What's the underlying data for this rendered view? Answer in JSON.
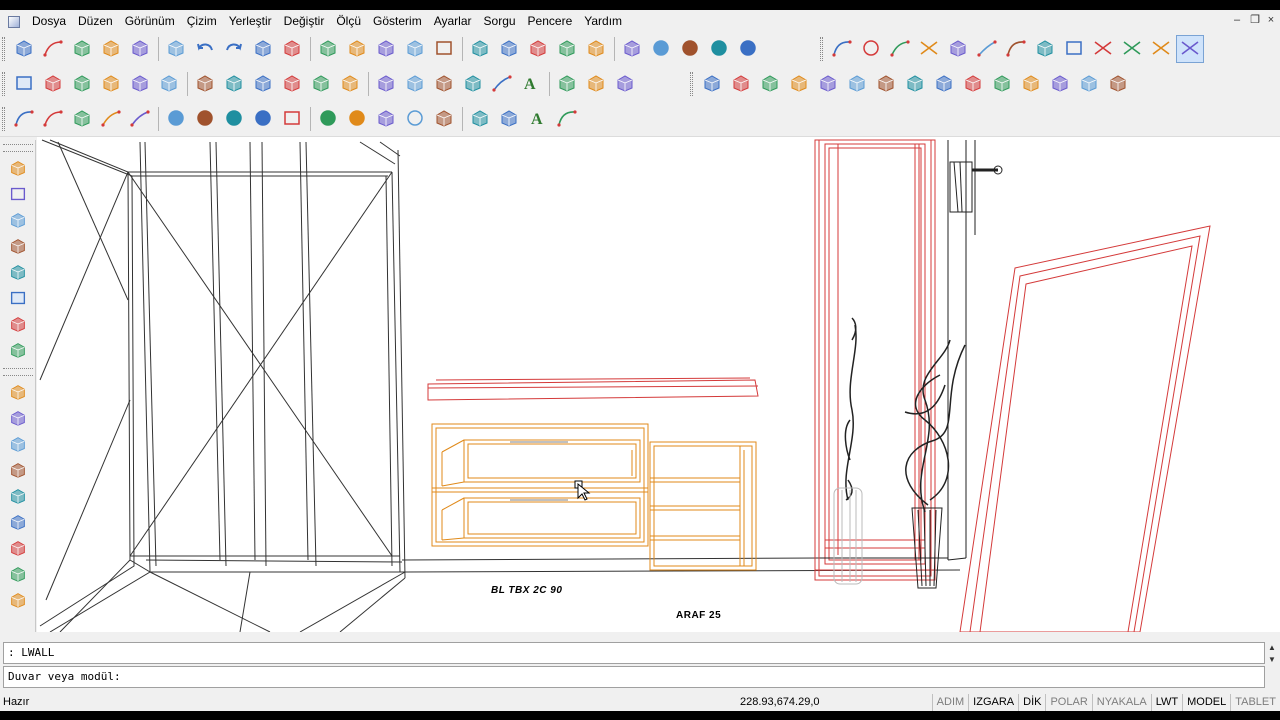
{
  "menubar": {
    "items": [
      "Dosya",
      "Düzen",
      "Görünüm",
      "Çizim",
      "Yerleştir",
      "Değiştir",
      "Ölçü",
      "Gösterim",
      "Ayarlar",
      "Sorgu",
      "Pencere",
      "Yardım"
    ]
  },
  "window_controls": [
    "minimize-icon",
    "restore-icon",
    "close-icon"
  ],
  "toolbars": {
    "row1": {
      "group1": [
        "new-icon",
        "open-icon",
        "save-icon",
        "print-icon",
        "plot-preview-icon",
        "publish-icon",
        "undo-icon",
        "redo-icon",
        "eraser-icon",
        "camera-icon",
        "measure-icon",
        "dimension-icon",
        "zoom-icon",
        "zoom-window-icon",
        "3d-box-icon",
        "3d-view-icon",
        "3d-solid-icon",
        "layers-icon",
        "eye-icon",
        "cube-wire-icon",
        "cube-render-icon",
        "sphere-red-icon",
        "sphere-red-2-icon",
        "sphere-multi-icon",
        "sphere-pink-icon"
      ],
      "group2": [
        "polyline-icon",
        "circle-icon",
        "line-icon",
        "trim-icon",
        "point-icon",
        "perpendicular-icon",
        "arc-icon",
        "polygon-icon",
        "rectangle-icon",
        "box-cross-icon",
        "extend-icon",
        "stretch-icon",
        "delete-cross-icon"
      ]
    },
    "row2": {
      "group1": [
        "grid-icon",
        "snap-icon",
        "ortho-icon",
        "osnap-icon",
        "tracking-icon",
        "rotate-icon",
        "mirror-icon",
        "move-icon",
        "copy-icon",
        "scale-icon",
        "ucs-icon",
        "layer-icon",
        "layers-stack-icon",
        "zoom-all-icon",
        "zoom-in-icon",
        "zoom-extents-icon",
        "dimension-linear-icon",
        "text-icon",
        "table-icon",
        "check-icon",
        "print-list-icon"
      ],
      "group2": [
        "module-1-icon",
        "module-2-icon",
        "module-3-icon",
        "module-4-icon",
        "module-5-icon",
        "module-6-icon",
        "module-7-icon",
        "module-8-icon",
        "lamp-icon",
        "tap-icon",
        "module-9-icon",
        "module-10-icon",
        "sink-icon",
        "door-icon",
        "moon-icon"
      ]
    },
    "row3": {
      "group1": [
        "draw-line-icon",
        "draw-arc-icon",
        "draw-hatch-icon",
        "draw-spline-icon",
        "draw-pen-icon",
        "node-1-icon",
        "node-2-icon",
        "node-3-icon",
        "node-4-icon",
        "insert-frame-icon",
        "rect-node-icon",
        "pentagon-node-icon",
        "arrow-shape-icon",
        "ring-icon",
        "solid-icon",
        "explode-icon",
        "hatch-icon",
        "text-a-icon",
        "text-a-underline-icon"
      ]
    }
  },
  "left_toolbar": {
    "group1": [
      "view-plan-icon",
      "view-box-icon",
      "view-side-icon",
      "view-iso-icon",
      "view-front-icon",
      "view-grid-icon",
      "view-render-icon",
      "view-wire-icon"
    ],
    "group2": [
      "cabinet-1-icon",
      "shelf-icon",
      "cabinet-2-icon",
      "cabinet-3-icon",
      "cabinet-4-icon",
      "tap-2-icon",
      "door-2-icon",
      "cabinet-5-icon",
      "cabinet-6-icon"
    ]
  },
  "viewport": {
    "labels": {
      "module_label": "BL TBX 2C 90",
      "shelf_label": "ARAF 25"
    }
  },
  "command": {
    "history": ": LWALL",
    "prompt": "Duvar veya modül:"
  },
  "statusbar": {
    "status": "Hazır",
    "coordinates": "228.93,674.29,0",
    "toggles": [
      {
        "label": "ADIM",
        "on": false
      },
      {
        "label": "IZGARA",
        "on": true
      },
      {
        "label": "DİK",
        "on": true
      },
      {
        "label": "POLAR",
        "on": false
      },
      {
        "label": "NYAKALA",
        "on": false
      },
      {
        "label": "LWT",
        "on": true
      },
      {
        "label": "MODEL",
        "on": true
      },
      {
        "label": "TABLET",
        "on": false
      }
    ]
  },
  "colors": {
    "orange_module": "#e08a1a",
    "red_module": "#d43a3a",
    "wire_black": "#222222",
    "accent_blue": "#2a6fd6"
  }
}
